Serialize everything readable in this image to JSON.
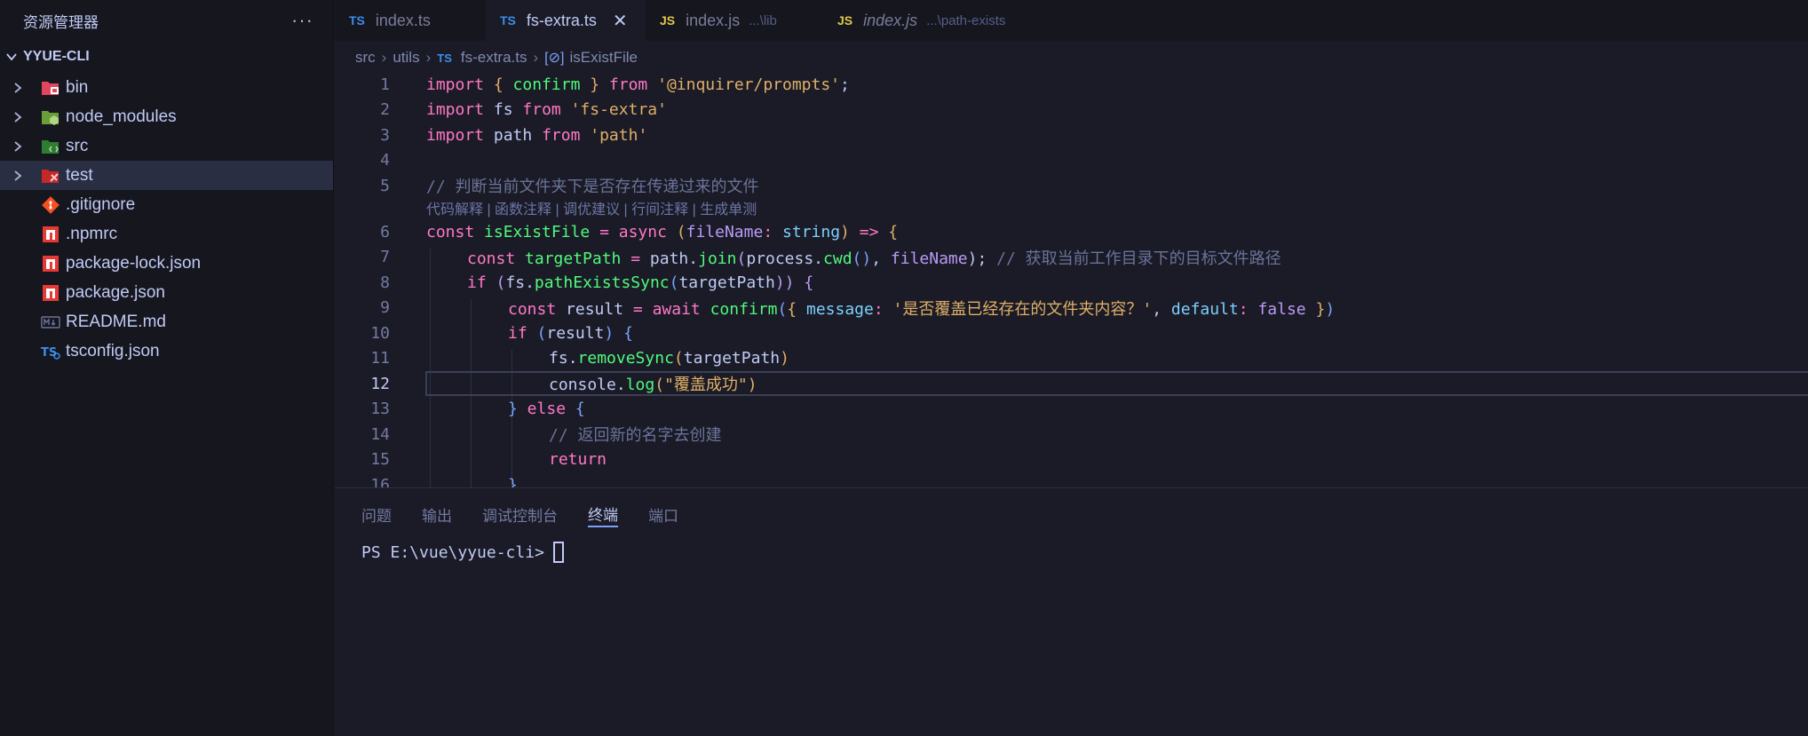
{
  "sidebar": {
    "title": "资源管理器",
    "more": "···",
    "root": "YYUE-CLI",
    "items": [
      {
        "label": "bin",
        "type": "folder",
        "icon": "folder-bin-icon",
        "color": "#e0465e"
      },
      {
        "label": "node_modules",
        "type": "folder",
        "icon": "folder-node-icon",
        "color": "#8bc34a"
      },
      {
        "label": "src",
        "type": "folder",
        "icon": "folder-src-icon",
        "color": "#4caf50"
      },
      {
        "label": "test",
        "type": "folder",
        "icon": "folder-test-icon",
        "color": "#e53935",
        "selected": true
      },
      {
        "label": ".gitignore",
        "type": "file",
        "icon": "git-icon",
        "color": "#f4511e"
      },
      {
        "label": ".npmrc",
        "type": "file",
        "icon": "npm-icon",
        "color": "#e53935"
      },
      {
        "label": "package-lock.json",
        "type": "file",
        "icon": "npm-icon",
        "color": "#e53935"
      },
      {
        "label": "package.json",
        "type": "file",
        "icon": "npm-icon",
        "color": "#e53935"
      },
      {
        "label": "README.md",
        "type": "file",
        "icon": "markdown-icon",
        "color": "#5c5f77"
      },
      {
        "label": "tsconfig.json",
        "type": "file",
        "icon": "tsconfig-icon",
        "color": "#3b8eea"
      }
    ]
  },
  "tabs": [
    {
      "lang": "TS",
      "name": "index.ts",
      "hint": "",
      "active": false
    },
    {
      "lang": "TS",
      "name": "fs-extra.ts",
      "hint": "",
      "active": true,
      "close": "✕"
    },
    {
      "lang": "JS",
      "name": "index.js",
      "hint": "...\\lib",
      "active": false
    },
    {
      "lang": "JS",
      "name": "index.js",
      "hint": "...\\path-exists",
      "active": false,
      "italic": true
    }
  ],
  "breadcrumb": {
    "parts": [
      "src",
      "utils"
    ],
    "file_lang": "TS",
    "file": "fs-extra.ts",
    "symbol_icon": "[⊘]",
    "symbol": "isExistFile"
  },
  "editor": {
    "current_line": 12,
    "line_numbers": [
      "1",
      "2",
      "3",
      "4",
      "5",
      "6",
      "7",
      "8",
      "9",
      "10",
      "11",
      "12",
      "13",
      "14",
      "15",
      "16"
    ],
    "codelens": "代码解释 | 函数注释 | 调优建议 | 行间注释 | 生成单测",
    "lines": {
      "l1": [
        "import",
        " { ",
        "confirm",
        " } ",
        "from",
        " '@inquirer/prompts'",
        ";"
      ],
      "l2": [
        "import",
        " fs ",
        "from",
        " 'fs-extra'"
      ],
      "l3": [
        "import",
        " path ",
        "from",
        " 'path'"
      ],
      "l5": "// 判断当前文件夹下是否存在传递过来的文件",
      "l6": [
        "const",
        " isExistFile ",
        "=",
        " async ",
        "(",
        "fileName",
        ": ",
        "string",
        ")",
        " => ",
        "{"
      ],
      "l7": [
        "const",
        " targetPath ",
        "=",
        " path",
        ".",
        "join",
        "(",
        "process",
        ".",
        "cwd",
        "()",
        ", ",
        "fileName",
        ");",
        " // 获取当前工作目录下的目标文件路径"
      ],
      "l8": [
        "if",
        " (",
        "fs",
        ".",
        "pathExistsSync",
        "(",
        "targetPath",
        "))",
        " {"
      ],
      "l9": [
        "const",
        " result ",
        "=",
        " await ",
        "confirm",
        "(",
        "{ ",
        "message",
        ": ",
        "'是否覆盖已经存在的文件夹内容？'",
        ", ",
        "default",
        ": ",
        "false",
        " }",
        ")"
      ],
      "l10": [
        "if",
        " (",
        "result",
        ")",
        " {"
      ],
      "l11": [
        "fs",
        ".",
        "removeSync",
        "(",
        "targetPath",
        ")"
      ],
      "l12": [
        "console",
        ".",
        "log",
        "(",
        "\"覆盖成功\"",
        ")"
      ],
      "l13": [
        "}",
        " else ",
        "{"
      ],
      "l14": "// 返回新的名字去创建",
      "l15": "return",
      "l16": "}"
    }
  },
  "panel": {
    "tabs": [
      "问题",
      "输出",
      "调试控制台",
      "终端",
      "端口"
    ],
    "active_tab": "终端",
    "prompt": "PS E:\\vue\\yyue-cli>"
  }
}
